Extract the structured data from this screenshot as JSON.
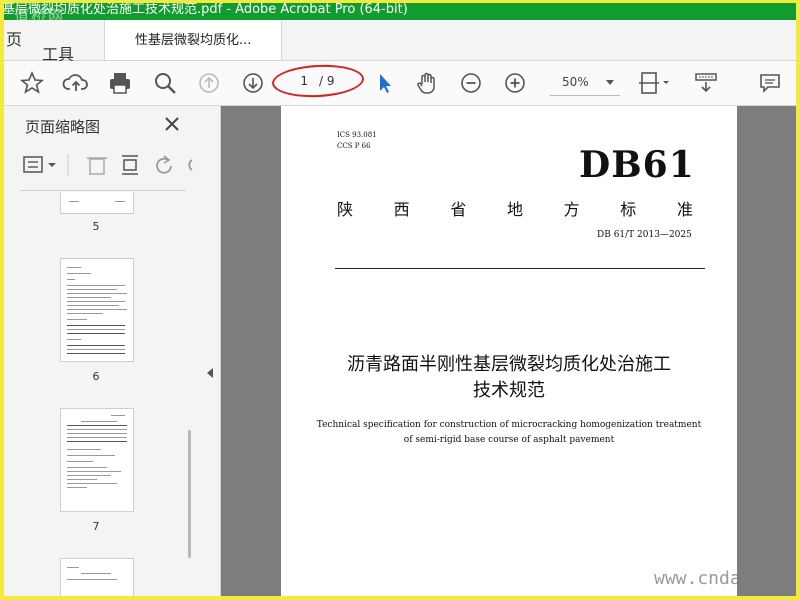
{
  "window": {
    "title": "基层微裂均质化处治施工技术规范.pdf - Adobe Acrobat Pro (64-bit)",
    "watermark": "道桥网"
  },
  "tabs": {
    "prev_partial": "页",
    "tools": "工具",
    "document": "性基层微裂均质化..."
  },
  "toolbar": {
    "page_current": "1",
    "page_total": "/ 9",
    "zoom": "50%",
    "icons": [
      "star-icon",
      "cloud-upload-icon",
      "printer-icon",
      "magnifier-icon",
      "arrow-up-icon",
      "arrow-down-icon",
      "cursor-icon",
      "hand-icon",
      "zoom-out-icon",
      "zoom-in-icon",
      "page-fit-icon",
      "scroll-mode-icon",
      "comment-icon"
    ]
  },
  "sidebar": {
    "title": "页面缩略图",
    "thumbnails": [
      {
        "label": "5"
      },
      {
        "label": "6"
      },
      {
        "label": "7"
      }
    ]
  },
  "document_page": {
    "ics": "ICS 93.081",
    "ccs": "CCS P 66",
    "code": "DB61",
    "province_chars": [
      "陕",
      "西",
      "省",
      "地",
      "方",
      "标",
      "准"
    ],
    "standard_number": "DB 61/T 2013—2025",
    "title_cn_line1": "沥青路面半刚性基层微裂均质化处治施工",
    "title_cn_line2": "技术规范",
    "title_en_line1": "Technical specification for construction of microcracking homogenization treatment",
    "title_en_line2": "of semi-rigid base course of asphalt pavement"
  },
  "site_watermark": "www.cnda",
  "colors": {
    "titlebar": "#119d2e",
    "frame": "#f2ea3d",
    "annotation_oval": "#d8231f",
    "doc_background": "#7d7d7d"
  }
}
